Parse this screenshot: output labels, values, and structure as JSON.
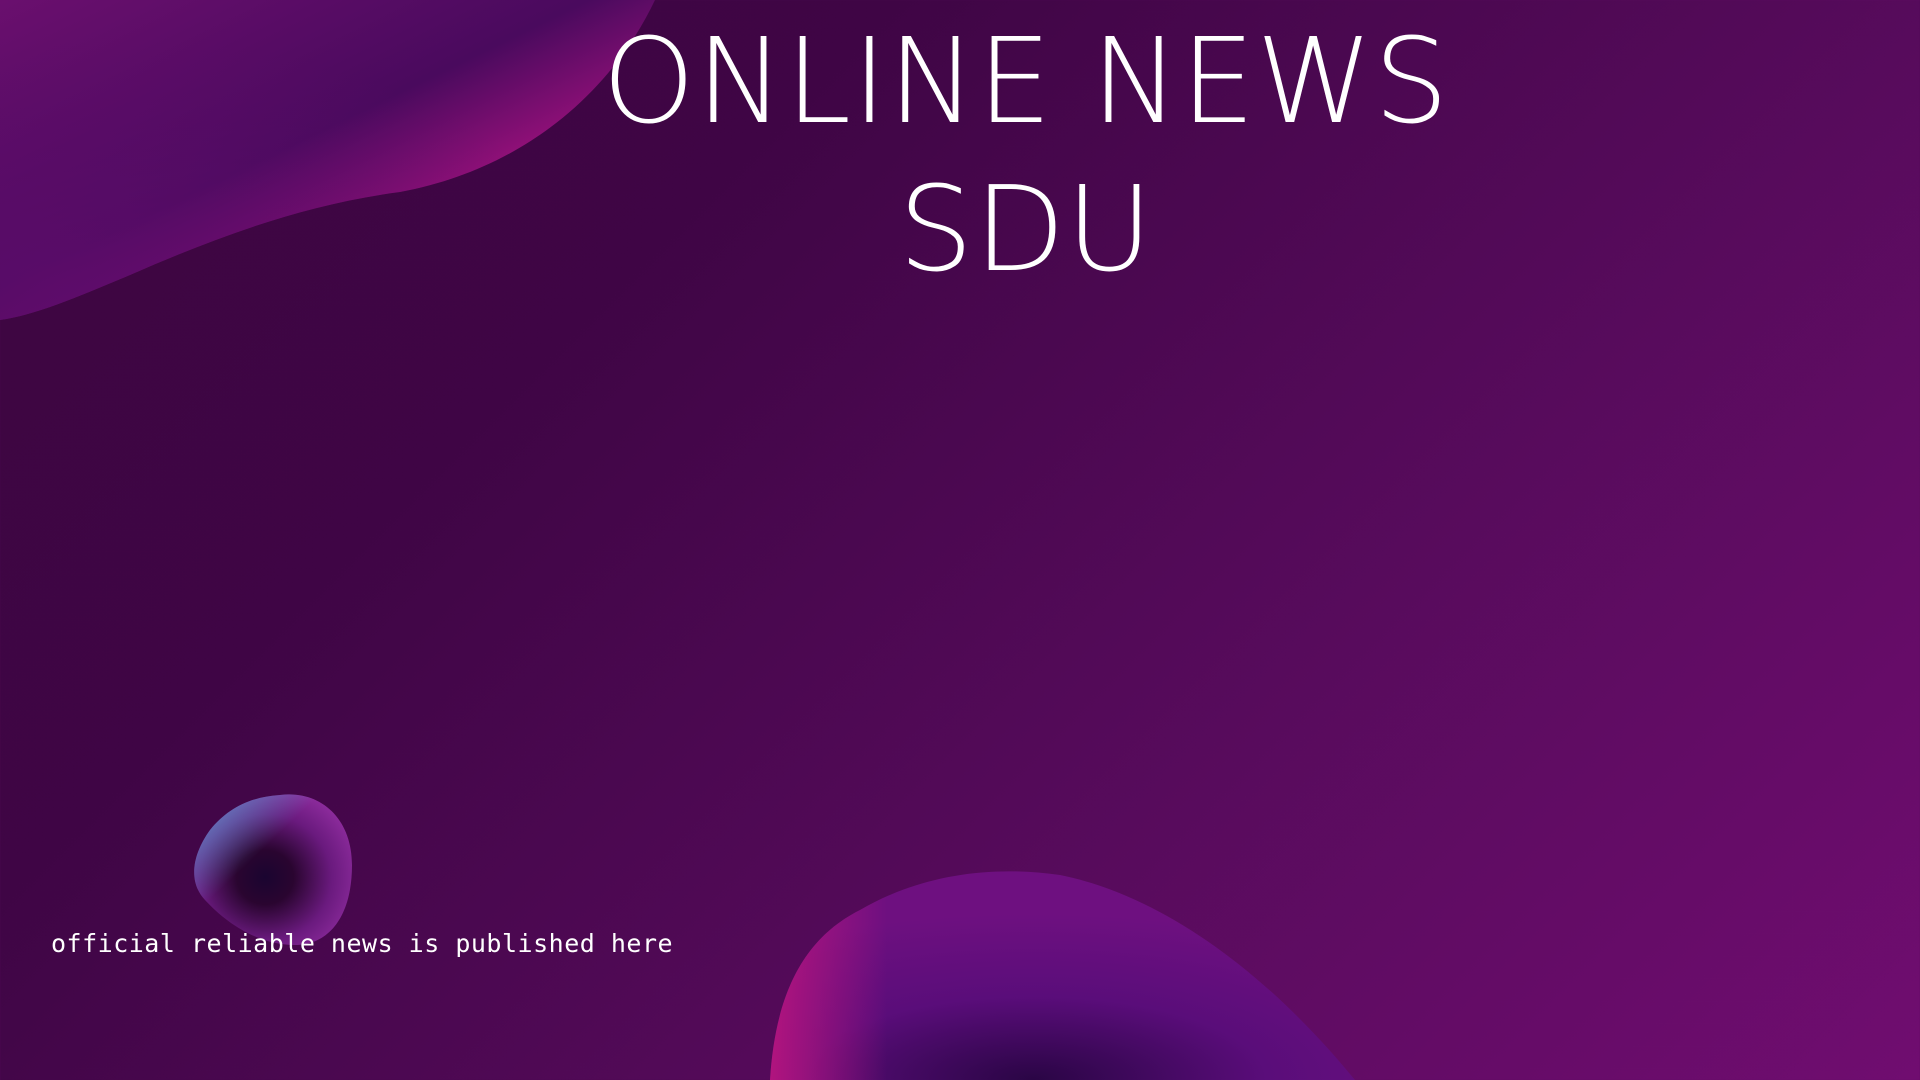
{
  "banner": {
    "title_line_1": "ONLINE NEWS",
    "title_line_2": "SDU",
    "tagline": "official reliable news is published here"
  },
  "colors": {
    "background_dark": "#3d0640",
    "background_light": "#700d70",
    "accent_pink": "#d9168f",
    "accent_violet": "#5a0d7a",
    "text": "#ffffff"
  }
}
